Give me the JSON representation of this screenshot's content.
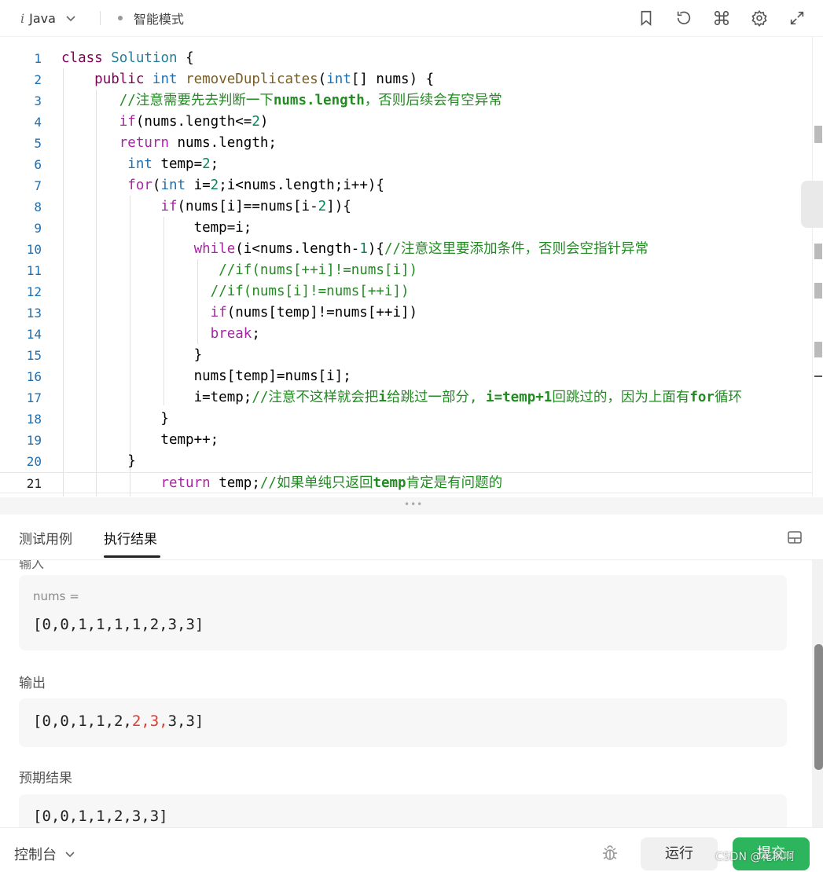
{
  "toolbar": {
    "language": "Java",
    "mode": "智能模式",
    "icons": [
      "bookmark-icon",
      "reset-icon",
      "command-icon",
      "gear-icon",
      "expand-icon"
    ]
  },
  "code_lines": [
    {
      "n": "1",
      "html": "<span class=\"kw\">class</span> <span class=\"cls\">Solution</span> {"
    },
    {
      "n": "2",
      "html": "    <span class=\"kw\">public</span> <span class=\"ty\">int</span> <span class=\"fn\">removeDuplicates</span>(<span class=\"ty\">int</span>[] nums) {"
    },
    {
      "n": "3",
      "html": "       <span class=\"cm\">//注意需要先去判断一下<b>nums.length</b>，否则后续会有空异常</span>"
    },
    {
      "n": "4",
      "html": "       <span class=\"kw2\">if</span>(nums.length&lt;=<span class=\"num\">2</span>)"
    },
    {
      "n": "5",
      "html": "       <span class=\"kw2\">return</span> nums.length;"
    },
    {
      "n": "6",
      "html": "        <span class=\"ty\">int</span> temp=<span class=\"num\">2</span>;"
    },
    {
      "n": "7",
      "html": "        <span class=\"kw2\">for</span>(<span class=\"ty\">int</span> i=<span class=\"num\">2</span>;i&lt;nums.length;i++){"
    },
    {
      "n": "8",
      "html": "            <span class=\"kw2\">if</span>(nums[i]==nums[i-<span class=\"num\">2</span>]){"
    },
    {
      "n": "9",
      "html": "                temp=i;"
    },
    {
      "n": "10",
      "html": "                <span class=\"kw2\">while</span>(i&lt;nums.length-<span class=\"num\">1</span>){<span class=\"cm\">//注意这里要添加条件，否则会空指针异常</span>"
    },
    {
      "n": "11",
      "html": "                   <span class=\"cm\">//if(nums[++i]!=nums[i])</span>"
    },
    {
      "n": "12",
      "html": "                  <span class=\"cm\">//if(nums[i]!=nums[++i])</span>"
    },
    {
      "n": "13",
      "html": "                  <span class=\"kw2\">if</span>(nums[temp]!=nums[++i])"
    },
    {
      "n": "14",
      "html": "                  <span class=\"kw2\">break</span>;"
    },
    {
      "n": "15",
      "html": "                }"
    },
    {
      "n": "16",
      "html": "                nums[temp]=nums[i];"
    },
    {
      "n": "17",
      "html": "                i=temp;<span class=\"cm\">//注意不这样就会把<b>i</b>给跳过一部分, <b>i=temp+1</b>回跳过的，因为上面有<b>for</b>循环</span>"
    },
    {
      "n": "18",
      "html": "            }"
    },
    {
      "n": "19",
      "html": "            temp++;"
    },
    {
      "n": "20",
      "html": "        }"
    },
    {
      "n": "21",
      "html": "            <span class=\"kw2\">return</span> temp;<span class=\"cm\">//如果单纯只返回<b>temp</b>肯定是有问题的</span>"
    }
  ],
  "tabs": {
    "test_cases": "测试用例",
    "result": "执行结果"
  },
  "results": {
    "input_label_clipped": "输入",
    "input_var": "nums =",
    "input_value": "[0,0,1,1,1,1,2,3,3]",
    "output_label": "输出",
    "output_value_pre": "[0,0,1,1,2,",
    "output_value_diff": "2,3,",
    "output_value_post": "3,3]",
    "expected_label": "预期结果",
    "expected_value": "[0,0,1,1,2,3,3]"
  },
  "bottom": {
    "console": "控制台",
    "run": "运行",
    "submit": "提交",
    "watermark": "CSDN @花枫啊"
  },
  "colors": {
    "submit_green": "#2db55d",
    "diff_red": "#e03a2e",
    "line_number_blue": "#1e70b3"
  }
}
